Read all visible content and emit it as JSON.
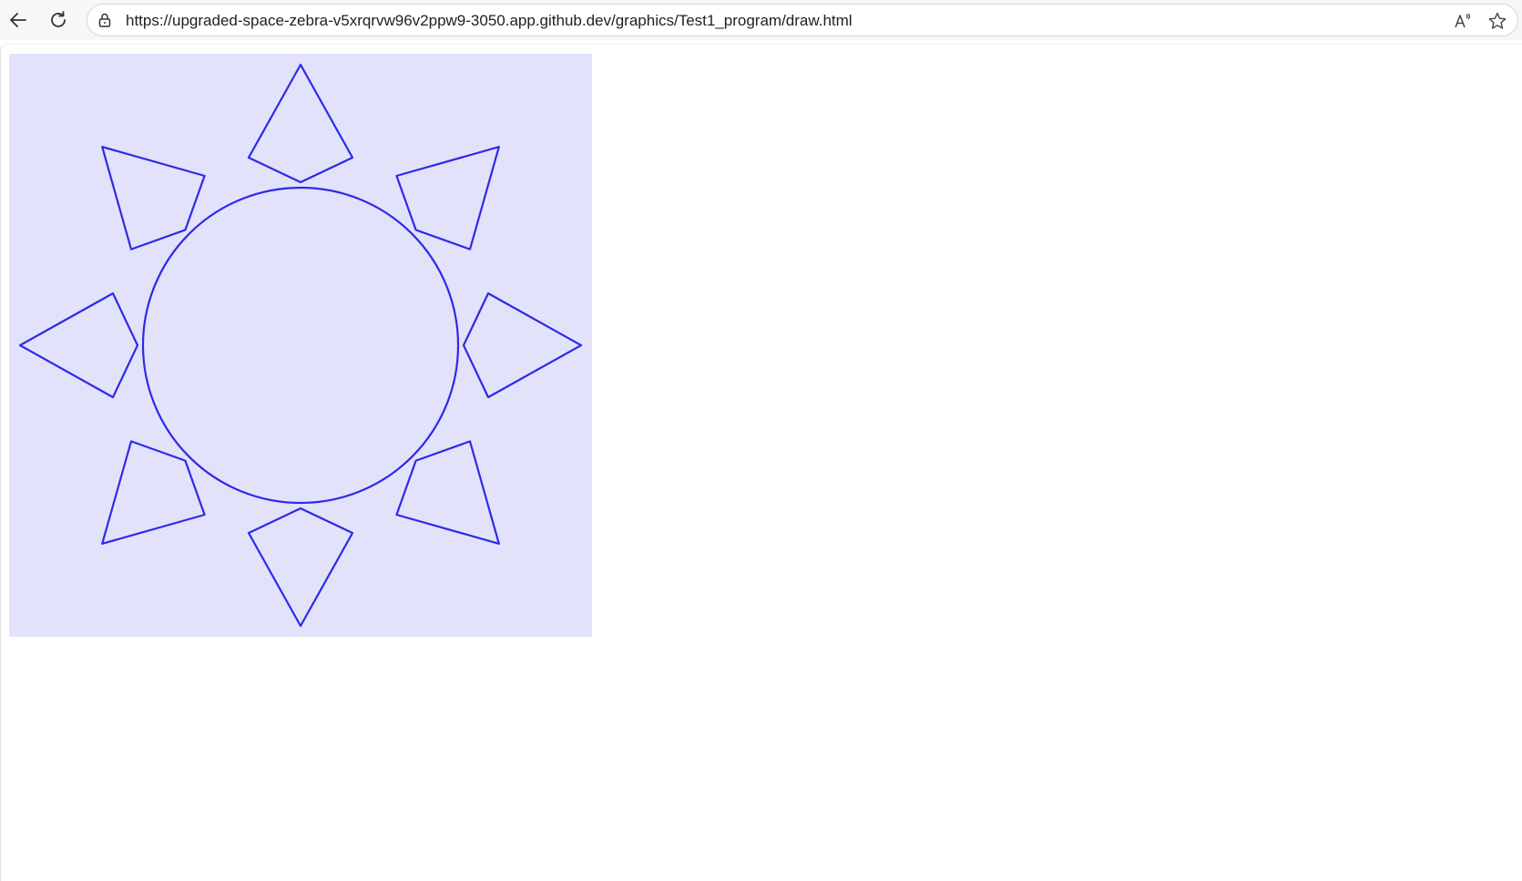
{
  "browser": {
    "url": "https://upgraded-space-zebra-v5xrqrvw96v2ppw9-3050.app.github.dev/graphics/Test1_program/draw.html",
    "icons": {
      "back": "back-arrow-icon",
      "reload": "reload-icon",
      "lock": "lock-icon",
      "read_aloud": "read-aloud-icon",
      "favorite": "star-icon"
    }
  },
  "canvas": {
    "background": "#e3e2fb",
    "stroke": "#2b2be8",
    "drawing": {
      "center_circle": true,
      "ray_count": 8
    }
  }
}
